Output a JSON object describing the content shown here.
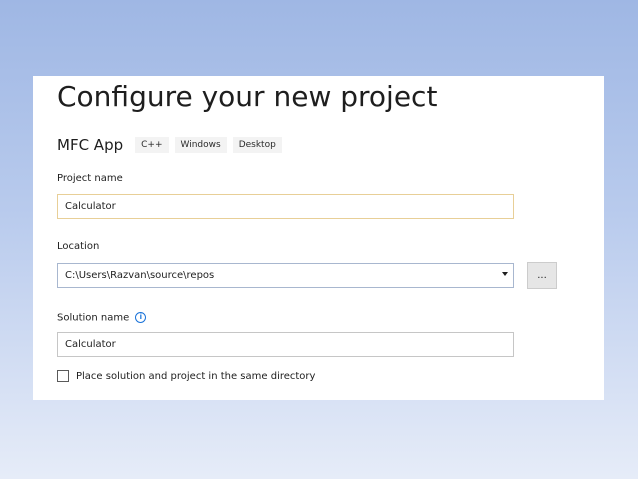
{
  "header": {
    "title": "Configure your new project"
  },
  "template": {
    "name": "MFC App",
    "tags": [
      "C++",
      "Windows",
      "Desktop"
    ]
  },
  "project_name": {
    "label": "Project name",
    "value": "Calculator"
  },
  "location": {
    "label": "Location",
    "value": "C:\\Users\\Razvan\\source\\repos",
    "browse_label": "..."
  },
  "solution_name": {
    "label": "Solution name",
    "info_glyph": "i",
    "value": "Calculator"
  },
  "same_directory": {
    "label": "Place solution and project in the same directory",
    "checked": false
  },
  "icons": {
    "dropdown": "chevron-down-icon",
    "info": "info-icon"
  }
}
